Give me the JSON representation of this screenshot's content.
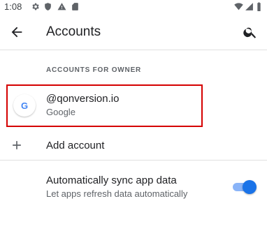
{
  "status_bar": {
    "time": "1:08",
    "icons_left": [
      "gear-icon",
      "shield-icon",
      "warning-icon",
      "sd-card-icon"
    ],
    "icons_right": [
      "wifi-icon",
      "cellular-icon",
      "battery-icon"
    ]
  },
  "app_bar": {
    "title": "Accounts",
    "back_icon": "arrow-back-icon",
    "search_icon": "search-icon"
  },
  "section": {
    "header": "ACCOUNTS FOR OWNER"
  },
  "account": {
    "email": "@qonversion.io",
    "type": "Google",
    "avatar_letter": "G"
  },
  "add_account": {
    "label": "Add account"
  },
  "sync": {
    "title": "Automatically sync app data",
    "subtitle": "Let apps refresh data automatically",
    "enabled": true
  },
  "colors": {
    "accent": "#1a73e8",
    "highlight_border": "#d50000",
    "text_primary": "#202124",
    "text_secondary": "#5f6368"
  }
}
